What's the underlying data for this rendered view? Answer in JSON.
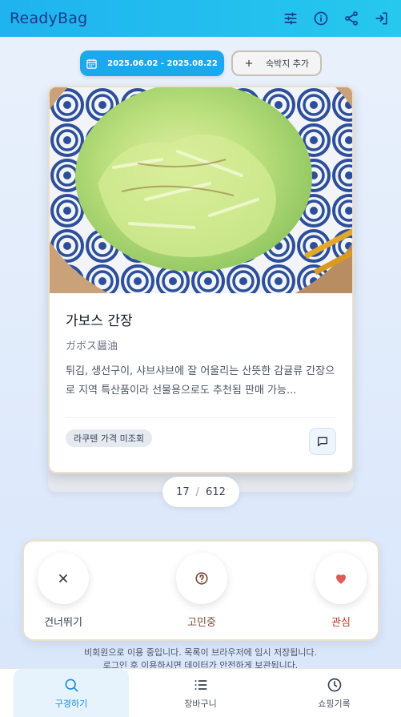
{
  "header": {
    "title": "ReadyBag",
    "icons": [
      "filter-sliders-icon",
      "info-icon",
      "share-icon",
      "login-icon"
    ]
  },
  "controls": {
    "date_range": "2025.06.02 - 2025.08.22",
    "add_lodging": "숙박지 추가"
  },
  "card": {
    "title": "가보스 간장",
    "subtitle": "ガボス醤油",
    "description": "튀김, 생선구이, 샤브샤브에 잘 어울리는 산뜻한 감귤류 간장으로 지역 특산품이라 선물용으로도 추천됨 판매 가능...",
    "price_badge": "라쿠텐 가격 미조회"
  },
  "counter": {
    "current": "17",
    "separator": "/",
    "total": "612"
  },
  "actions": {
    "skip": "건너뛰기",
    "thinking": "고민중",
    "interest": "관심"
  },
  "notice": {
    "line1": "비회원으로 이용 중입니다. 목록이 브라우저에 임시 저장됩니다.",
    "line2": "로그인 후 이용하시면 데이터가 안전하게 보관됩니다."
  },
  "nav": {
    "browse": "구경하기",
    "cart": "장바구니",
    "history": "쇼핑기록"
  },
  "colors": {
    "accent": "#1aa9ec",
    "header_text": "#1a3b8a",
    "like": "#e05a5a"
  }
}
